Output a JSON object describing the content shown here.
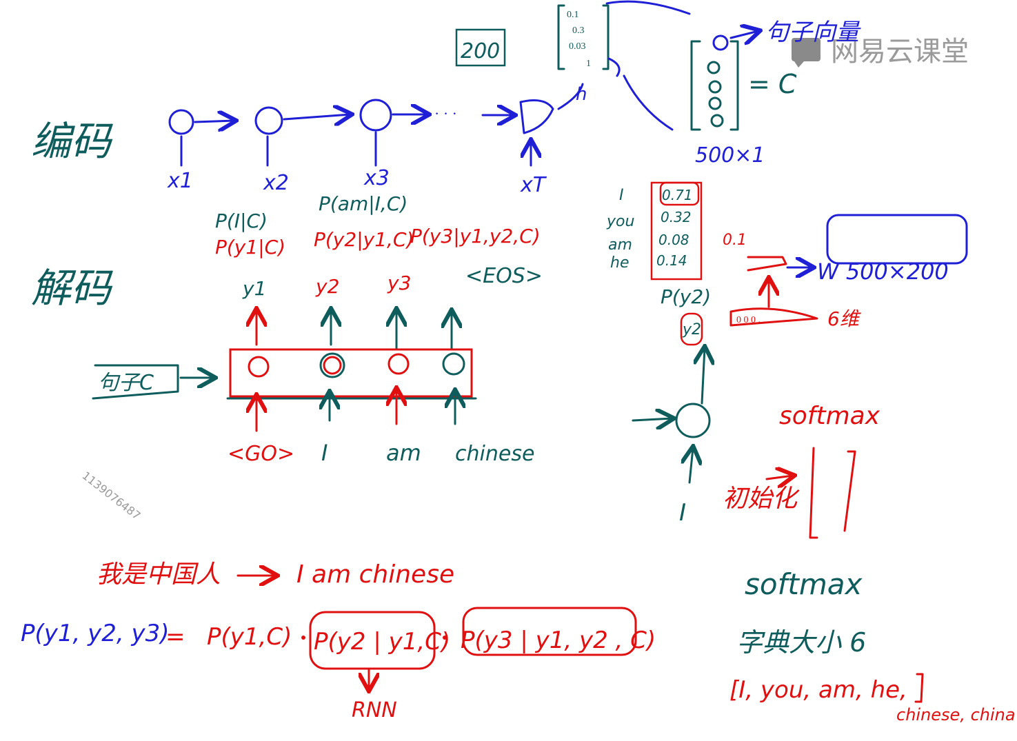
{
  "watermark": {
    "brand": "网易云课堂",
    "user_id": "1139076487"
  },
  "encoder": {
    "label": "编码",
    "inputs": [
      "x1",
      "x2",
      "x3",
      "xT"
    ],
    "hidden_size_box": "200",
    "vector_values": [
      "0.1",
      "0.3",
      "0.03",
      "1"
    ],
    "h_label": "h",
    "sentence_vector_label": "句子向量",
    "c_label": "= C",
    "c_size": "500×1"
  },
  "decoder": {
    "label": "解码",
    "context_box": "句子C",
    "outputs": [
      "y1",
      "y2",
      "y3",
      "<EOS>"
    ],
    "inputs": [
      "<GO>",
      "I",
      "am",
      "chinese"
    ],
    "probs_black": [
      "P(I|C)",
      "P(am|I,C)"
    ],
    "probs_red": [
      "P(y1|C)",
      "P(y2|y1,C)",
      "P(y3|y1,y2,C)"
    ]
  },
  "softmax_panel": {
    "words": [
      "I",
      "you",
      "am",
      "he"
    ],
    "values": [
      "0.71",
      "0.32",
      "0.08",
      "0.14"
    ],
    "extra_value": "0.1",
    "matrix_label": "W 500×200",
    "vocab_dim_label": "6维",
    "py_label": "P(y2)",
    "y_node": "y2",
    "input": "I",
    "init_label": "初始化",
    "softmax": "softmax"
  },
  "bottom": {
    "translation_cn": "我是中国人",
    "translation_en": "I  am  chinese",
    "formula_lhs": "P(y1, y2, y3)",
    "formula_eq": "=",
    "formula_t1": "P(y1,C)",
    "formula_t2": "P(y2 | y1,C)",
    "formula_t3": "P(y3 | y1, y2 , C)",
    "rnn": "RNN",
    "softmax": "softmax",
    "vocab_size": "字典大小 6",
    "vocab_list": "[I, you, am, he,",
    "vocab_list2": "chinese, china"
  }
}
